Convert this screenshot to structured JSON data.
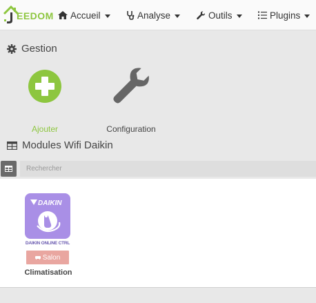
{
  "brand": {
    "name": "EEDOM"
  },
  "nav": [
    {
      "label": "Accueil",
      "icon": "home-icon"
    },
    {
      "label": "Analyse",
      "icon": "stethoscope-icon"
    },
    {
      "label": "Outils",
      "icon": "wrench-icon"
    },
    {
      "label": "Plugins",
      "icon": "list-icon"
    }
  ],
  "gestion": {
    "title": "Gestion",
    "add_label": "Ajouter",
    "config_label": "Configuration"
  },
  "modules": {
    "title": "Modules Wifi Daikin",
    "search_placeholder": "Rechercher",
    "items": [
      {
        "logo_text": "DAIKIN",
        "caption": "DAIKIN ONLINE CTRL",
        "badge": "Salon",
        "name": "Climatisation"
      }
    ]
  },
  "colors": {
    "accent": "#8dc63f",
    "badge": "#e9a6a0",
    "logo_bg": "#a98fe6"
  }
}
